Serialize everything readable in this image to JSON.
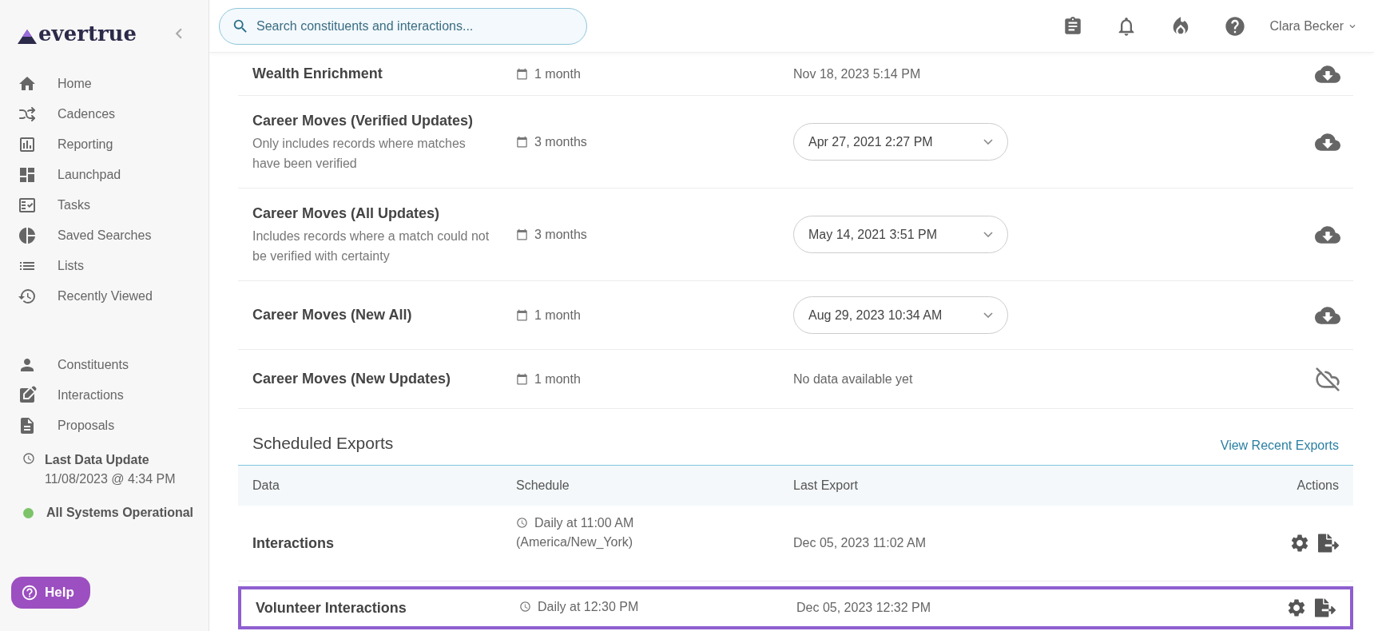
{
  "sidebar": {
    "logo": "evertrue",
    "nav_primary": [
      {
        "label": "Home"
      },
      {
        "label": "Cadences"
      },
      {
        "label": "Reporting"
      },
      {
        "label": "Launchpad"
      },
      {
        "label": "Tasks"
      },
      {
        "label": "Saved Searches"
      },
      {
        "label": "Lists"
      },
      {
        "label": "Recently Viewed"
      }
    ],
    "nav_secondary": [
      {
        "label": "Constituents"
      },
      {
        "label": "Interactions"
      },
      {
        "label": "Proposals"
      }
    ],
    "last_update": {
      "label": "Last Data Update",
      "value": "11/08/2023 @ 4:34 PM"
    },
    "status": {
      "label": "All Systems Operational",
      "color": "#7cc36a"
    },
    "help_button": "Help"
  },
  "topbar": {
    "search": {
      "placeholder": "Search constituents and interactions..."
    },
    "user_name": "Clara Becker"
  },
  "data_feeds": [
    {
      "name": "Wealth Enrichment",
      "duration": "1 month",
      "last_update": {
        "kind": "text",
        "value": "Nov 18, 2023 5:14 PM"
      },
      "action": {
        "kind": "download"
      }
    },
    {
      "name": "Career Moves (Verified Updates)",
      "description": "Only includes records where matches have been verified",
      "duration": "3 months",
      "last_update": {
        "kind": "dropdown",
        "value": "Apr 27, 2021 2:27 PM"
      },
      "action": {
        "kind": "download"
      }
    },
    {
      "name": "Career Moves (All Updates)",
      "description": "Includes records where a match could not be verified with certainty",
      "duration": "3 months",
      "last_update": {
        "kind": "dropdown",
        "value": "May 14, 2021 3:51 PM"
      },
      "action": {
        "kind": "download"
      }
    },
    {
      "name": "Career Moves (New All)",
      "duration": "1 month",
      "last_update": {
        "kind": "dropdown",
        "value": "Aug 29, 2023 10:34 AM"
      },
      "action": {
        "kind": "download"
      }
    },
    {
      "name": "Career Moves (New Updates)",
      "duration": "1 month",
      "last_update": {
        "kind": "text",
        "value": "No data available yet"
      },
      "action": {
        "kind": "unavailable"
      }
    }
  ],
  "scheduled_exports": {
    "title": "Scheduled Exports",
    "link": "View Recent Exports",
    "columns": [
      "Data",
      "Schedule",
      "Last Export",
      "Actions"
    ],
    "rows": [
      {
        "data": "Interactions",
        "schedule": [
          "Daily at 11:00 AM",
          "(America/New_York)"
        ],
        "last_export": "Dec 05, 2023 11:02 AM",
        "highlighted": false
      },
      {
        "data": "Volunteer Interactions",
        "schedule": [
          "Daily at 12:30 PM"
        ],
        "last_export": "Dec 05, 2023 12:32 PM",
        "highlighted": true
      }
    ]
  }
}
